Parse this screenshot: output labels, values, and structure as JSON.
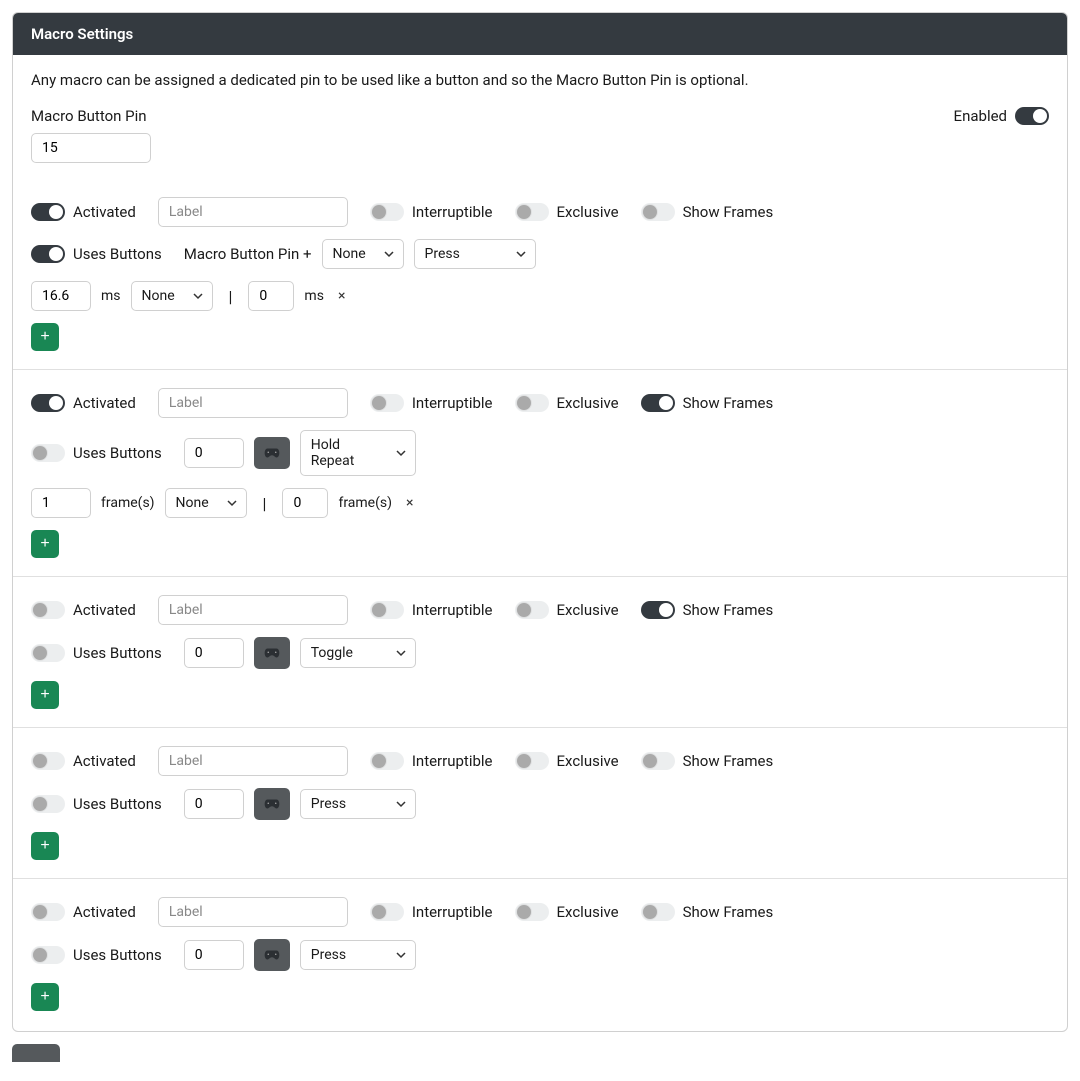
{
  "panel": {
    "title": "Macro Settings",
    "intro": "Any macro can be assigned a dedicated pin to be used like a button and so the Macro Button Pin is optional.",
    "pin_label": "Macro Button Pin",
    "pin_value": "15",
    "enabled_label": "Enabled",
    "enabled": true
  },
  "labels": {
    "activated": "Activated",
    "interruptible": "Interruptible",
    "exclusive": "Exclusive",
    "show_frames": "Show Frames",
    "uses_buttons": "Uses Buttons",
    "macro_pin_plus": "Macro Button Pin +",
    "ms": "ms",
    "frames": "frame(s)",
    "pipe": "|",
    "remove": "×",
    "add": "+",
    "label_placeholder": "Label"
  },
  "selects": {
    "none": "None",
    "press": "Press",
    "hold_repeat": "Hold Repeat",
    "toggle": "Toggle"
  },
  "macros": [
    {
      "activated": true,
      "interruptible": false,
      "exclusive": false,
      "show_frames": false,
      "uses_buttons": true,
      "uses_buttons_mode": "pin_plus",
      "combo_select": "None",
      "trigger_select": "Press",
      "timing": {
        "dur_a": "16.6",
        "unit_a": "ms",
        "mid_select": "None",
        "dur_b": "0",
        "unit_b": "ms",
        "show_remove": true
      }
    },
    {
      "activated": true,
      "interruptible": false,
      "exclusive": false,
      "show_frames": true,
      "uses_buttons": false,
      "uses_buttons_mode": "pin_value",
      "pin_value": "0",
      "trigger_select": "Hold Repeat",
      "timing": {
        "dur_a": "1",
        "unit_a": "frame(s)",
        "mid_select": "None",
        "dur_b": "0",
        "unit_b": "frame(s)",
        "show_remove": true
      }
    },
    {
      "activated": false,
      "interruptible": false,
      "exclusive": false,
      "show_frames": true,
      "uses_buttons": false,
      "uses_buttons_mode": "pin_value",
      "pin_value": "0",
      "trigger_select": "Toggle",
      "timing": null
    },
    {
      "activated": false,
      "interruptible": false,
      "exclusive": false,
      "show_frames": false,
      "uses_buttons": false,
      "uses_buttons_mode": "pin_value",
      "pin_value": "0",
      "trigger_select": "Press",
      "timing": null
    },
    {
      "activated": false,
      "interruptible": false,
      "exclusive": false,
      "show_frames": false,
      "uses_buttons": false,
      "uses_buttons_mode": "pin_value",
      "pin_value": "0",
      "trigger_select": "Press",
      "timing": null
    }
  ]
}
